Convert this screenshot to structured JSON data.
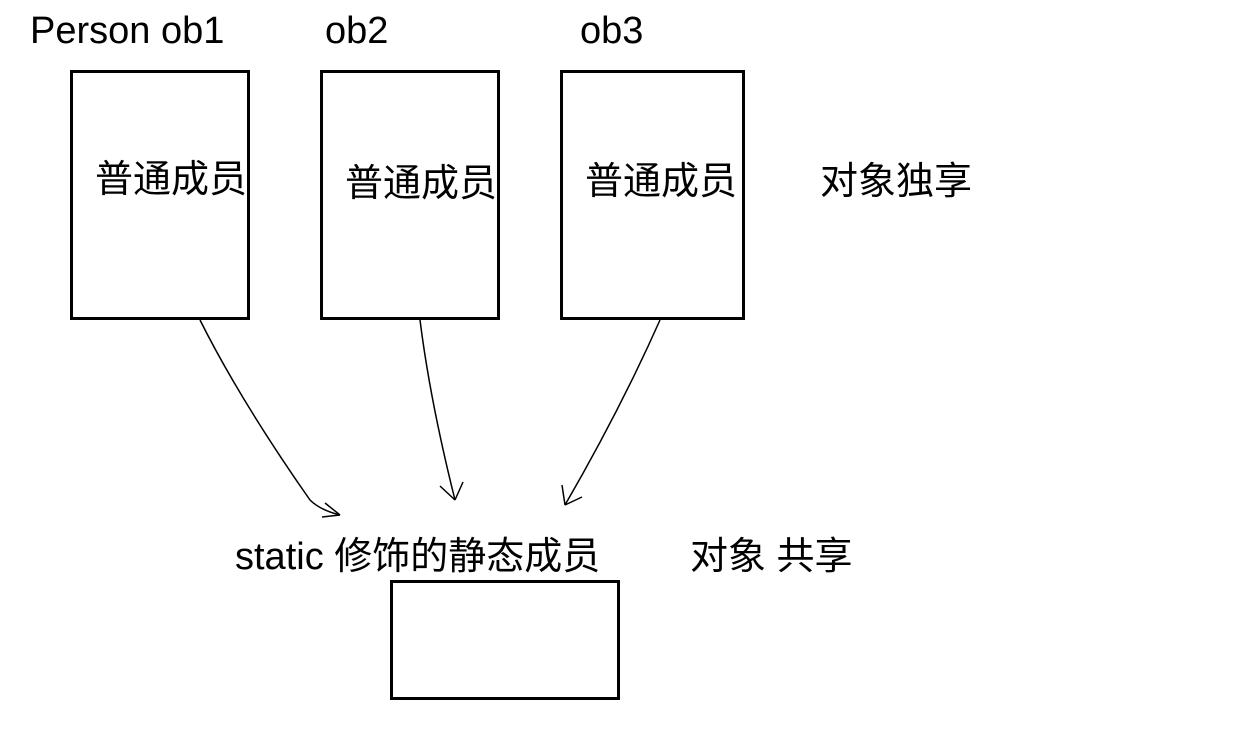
{
  "objects": [
    {
      "label": "Person ob1",
      "member": "普通成员"
    },
    {
      "label": "ob2",
      "member": "普通成员"
    },
    {
      "label": "ob3",
      "member": "普通成员"
    }
  ],
  "side_label": "对象独享",
  "static_text_1": "static 修饰的静态成员",
  "static_text_2": "对象 共享"
}
